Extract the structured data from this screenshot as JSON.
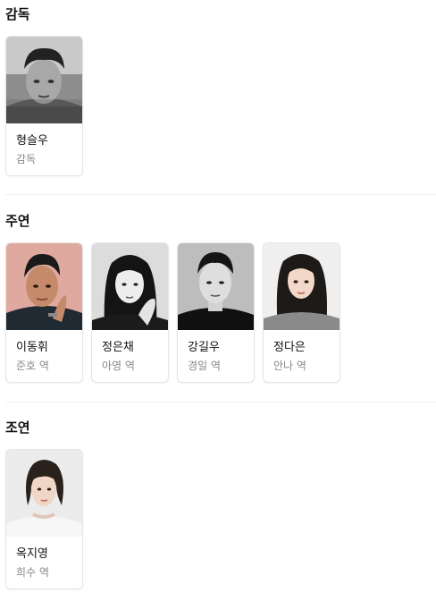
{
  "sections": [
    {
      "title": "감독",
      "people": [
        {
          "name": "형슬우",
          "role": "감독"
        }
      ]
    },
    {
      "title": "주연",
      "people": [
        {
          "name": "이동휘",
          "role": "준호 역"
        },
        {
          "name": "정은채",
          "role": "아영 역"
        },
        {
          "name": "강길우",
          "role": "경일 역"
        },
        {
          "name": "정다은",
          "role": "안나 역"
        }
      ]
    },
    {
      "title": "조연",
      "people": [
        {
          "name": "옥지영",
          "role": "희수 역"
        }
      ]
    }
  ]
}
